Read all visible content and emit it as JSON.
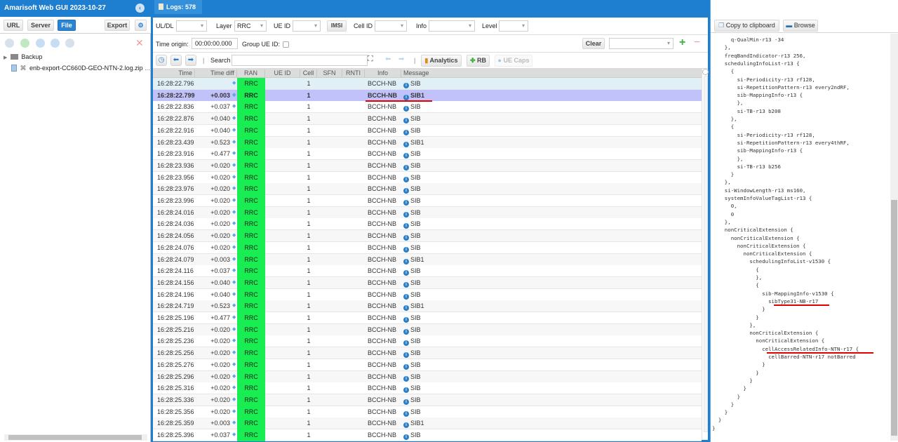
{
  "app": {
    "title": "Amarisoft Web GUI 2023-10-27",
    "left_tabs": [
      "URL",
      "Server",
      "File"
    ],
    "active_left_tab": "File",
    "export_label": "Export",
    "tree": [
      {
        "type": "folder",
        "label": "Backup"
      },
      {
        "type": "file",
        "label": "enb-export-CC660D-GEO-NTN-2.log.zip",
        "suffix": "..."
      }
    ]
  },
  "logs_tab": {
    "label": "Logs: 578"
  },
  "filters": {
    "uldl": {
      "label": "UL/DL",
      "value": ""
    },
    "layer": {
      "label": "Layer",
      "value": "RRC"
    },
    "ueid": {
      "label": "UE ID",
      "value": ""
    },
    "imsi_label": "IMSI",
    "cellid": {
      "label": "Cell ID",
      "value": ""
    },
    "info": {
      "label": "Info",
      "value": ""
    },
    "level": {
      "label": "Level",
      "value": ""
    },
    "time_origin": {
      "label": "Time origin:",
      "value": "00:00:00.000"
    },
    "group_ueid": {
      "label": "Group UE ID:",
      "checked": false
    },
    "clear_label": "Clear",
    "preset_value": ""
  },
  "toolbar": {
    "search_label": "Search",
    "search_value": "",
    "analytics_label": "Analytics",
    "rb_label": "RB",
    "uecaps_label": "UE Caps"
  },
  "table": {
    "columns": [
      "Time",
      "Time diff",
      "RAN",
      "UE ID",
      "Cell",
      "SFN",
      "RNTI",
      "Info",
      "Message"
    ],
    "selected_index": 1,
    "rows": [
      {
        "time": "16:28:22.796",
        "diff": "",
        "ran": "RRC",
        "ueid": "",
        "cell": "1",
        "sfn": "",
        "rnti": "",
        "info": "BCCH-NB",
        "msg": "SIB"
      },
      {
        "time": "16:28:22.799",
        "diff": "+0.003",
        "ran": "RRC",
        "ueid": "",
        "cell": "1",
        "sfn": "",
        "rnti": "",
        "info": "BCCH-NB",
        "msg": "SIB1"
      },
      {
        "time": "16:28:22.836",
        "diff": "+0.037",
        "ran": "RRC",
        "ueid": "",
        "cell": "1",
        "sfn": "",
        "rnti": "",
        "info": "BCCH-NB",
        "msg": "SIB"
      },
      {
        "time": "16:28:22.876",
        "diff": "+0.040",
        "ran": "RRC",
        "ueid": "",
        "cell": "1",
        "sfn": "",
        "rnti": "",
        "info": "BCCH-NB",
        "msg": "SIB"
      },
      {
        "time": "16:28:22.916",
        "diff": "+0.040",
        "ran": "RRC",
        "ueid": "",
        "cell": "1",
        "sfn": "",
        "rnti": "",
        "info": "BCCH-NB",
        "msg": "SIB"
      },
      {
        "time": "16:28:23.439",
        "diff": "+0.523",
        "ran": "RRC",
        "ueid": "",
        "cell": "1",
        "sfn": "",
        "rnti": "",
        "info": "BCCH-NB",
        "msg": "SIB1"
      },
      {
        "time": "16:28:23.916",
        "diff": "+0.477",
        "ran": "RRC",
        "ueid": "",
        "cell": "1",
        "sfn": "",
        "rnti": "",
        "info": "BCCH-NB",
        "msg": "SIB"
      },
      {
        "time": "16:28:23.936",
        "diff": "+0.020",
        "ran": "RRC",
        "ueid": "",
        "cell": "1",
        "sfn": "",
        "rnti": "",
        "info": "BCCH-NB",
        "msg": "SIB"
      },
      {
        "time": "16:28:23.956",
        "diff": "+0.020",
        "ran": "RRC",
        "ueid": "",
        "cell": "1",
        "sfn": "",
        "rnti": "",
        "info": "BCCH-NB",
        "msg": "SIB"
      },
      {
        "time": "16:28:23.976",
        "diff": "+0.020",
        "ran": "RRC",
        "ueid": "",
        "cell": "1",
        "sfn": "",
        "rnti": "",
        "info": "BCCH-NB",
        "msg": "SIB"
      },
      {
        "time": "16:28:23.996",
        "diff": "+0.020",
        "ran": "RRC",
        "ueid": "",
        "cell": "1",
        "sfn": "",
        "rnti": "",
        "info": "BCCH-NB",
        "msg": "SIB"
      },
      {
        "time": "16:28:24.016",
        "diff": "+0.020",
        "ran": "RRC",
        "ueid": "",
        "cell": "1",
        "sfn": "",
        "rnti": "",
        "info": "BCCH-NB",
        "msg": "SIB"
      },
      {
        "time": "16:28:24.036",
        "diff": "+0.020",
        "ran": "RRC",
        "ueid": "",
        "cell": "1",
        "sfn": "",
        "rnti": "",
        "info": "BCCH-NB",
        "msg": "SIB"
      },
      {
        "time": "16:28:24.056",
        "diff": "+0.020",
        "ran": "RRC",
        "ueid": "",
        "cell": "1",
        "sfn": "",
        "rnti": "",
        "info": "BCCH-NB",
        "msg": "SIB"
      },
      {
        "time": "16:28:24.076",
        "diff": "+0.020",
        "ran": "RRC",
        "ueid": "",
        "cell": "1",
        "sfn": "",
        "rnti": "",
        "info": "BCCH-NB",
        "msg": "SIB"
      },
      {
        "time": "16:28:24.079",
        "diff": "+0.003",
        "ran": "RRC",
        "ueid": "",
        "cell": "1",
        "sfn": "",
        "rnti": "",
        "info": "BCCH-NB",
        "msg": "SIB1"
      },
      {
        "time": "16:28:24.116",
        "diff": "+0.037",
        "ran": "RRC",
        "ueid": "",
        "cell": "1",
        "sfn": "",
        "rnti": "",
        "info": "BCCH-NB",
        "msg": "SIB"
      },
      {
        "time": "16:28:24.156",
        "diff": "+0.040",
        "ran": "RRC",
        "ueid": "",
        "cell": "1",
        "sfn": "",
        "rnti": "",
        "info": "BCCH-NB",
        "msg": "SIB"
      },
      {
        "time": "16:28:24.196",
        "diff": "+0.040",
        "ran": "RRC",
        "ueid": "",
        "cell": "1",
        "sfn": "",
        "rnti": "",
        "info": "BCCH-NB",
        "msg": "SIB"
      },
      {
        "time": "16:28:24.719",
        "diff": "+0.523",
        "ran": "RRC",
        "ueid": "",
        "cell": "1",
        "sfn": "",
        "rnti": "",
        "info": "BCCH-NB",
        "msg": "SIB1"
      },
      {
        "time": "16:28:25.196",
        "diff": "+0.477",
        "ran": "RRC",
        "ueid": "",
        "cell": "1",
        "sfn": "",
        "rnti": "",
        "info": "BCCH-NB",
        "msg": "SIB"
      },
      {
        "time": "16:28:25.216",
        "diff": "+0.020",
        "ran": "RRC",
        "ueid": "",
        "cell": "1",
        "sfn": "",
        "rnti": "",
        "info": "BCCH-NB",
        "msg": "SIB"
      },
      {
        "time": "16:28:25.236",
        "diff": "+0.020",
        "ran": "RRC",
        "ueid": "",
        "cell": "1",
        "sfn": "",
        "rnti": "",
        "info": "BCCH-NB",
        "msg": "SIB"
      },
      {
        "time": "16:28:25.256",
        "diff": "+0.020",
        "ran": "RRC",
        "ueid": "",
        "cell": "1",
        "sfn": "",
        "rnti": "",
        "info": "BCCH-NB",
        "msg": "SIB"
      },
      {
        "time": "16:28:25.276",
        "diff": "+0.020",
        "ran": "RRC",
        "ueid": "",
        "cell": "1",
        "sfn": "",
        "rnti": "",
        "info": "BCCH-NB",
        "msg": "SIB"
      },
      {
        "time": "16:28:25.296",
        "diff": "+0.020",
        "ran": "RRC",
        "ueid": "",
        "cell": "1",
        "sfn": "",
        "rnti": "",
        "info": "BCCH-NB",
        "msg": "SIB"
      },
      {
        "time": "16:28:25.316",
        "diff": "+0.020",
        "ran": "RRC",
        "ueid": "",
        "cell": "1",
        "sfn": "",
        "rnti": "",
        "info": "BCCH-NB",
        "msg": "SIB"
      },
      {
        "time": "16:28:25.336",
        "diff": "+0.020",
        "ran": "RRC",
        "ueid": "",
        "cell": "1",
        "sfn": "",
        "rnti": "",
        "info": "BCCH-NB",
        "msg": "SIB"
      },
      {
        "time": "16:28:25.356",
        "diff": "+0.020",
        "ran": "RRC",
        "ueid": "",
        "cell": "1",
        "sfn": "",
        "rnti": "",
        "info": "BCCH-NB",
        "msg": "SIB"
      },
      {
        "time": "16:28:25.359",
        "diff": "+0.003",
        "ran": "RRC",
        "ueid": "",
        "cell": "1",
        "sfn": "",
        "rnti": "",
        "info": "BCCH-NB",
        "msg": "SIB1"
      },
      {
        "time": "16:28:25.396",
        "diff": "+0.037",
        "ran": "RRC",
        "ueid": "",
        "cell": "1",
        "sfn": "",
        "rnti": "",
        "info": "BCCH-NB",
        "msg": "SIB"
      }
    ]
  },
  "detail": {
    "copy_label": "Copy to clipboard",
    "browse_label": "Browse",
    "highlighted_lines": [
      29,
      35
    ],
    "lines": [
      "      q-QualMin-r13 -34",
      "    },",
      "    freqBandIndicator-r13 256,",
      "    schedulingInfoList-r13 {",
      "      {",
      "        si-Periodicity-r13 rf128,",
      "        si-RepetitionPattern-r13 every2ndRF,",
      "        sib-MappingInfo-r13 {",
      "        },",
      "        si-TB-r13 b208",
      "      },",
      "      {",
      "        si-Periodicity-r13 rf128,",
      "        si-RepetitionPattern-r13 every4thRF,",
      "        sib-MappingInfo-r13 {",
      "        },",
      "        si-TB-r13 b256",
      "      }",
      "    },",
      "    si-WindowLength-r13 ms160,",
      "    systemInfoValueTagList-r13 {",
      "      0,",
      "      0",
      "    },",
      "    nonCriticalExtension {",
      "      nonCriticalExtension {",
      "        nonCriticalExtension {",
      "          nonCriticalExtension {",
      "            schedulingInfoList-v1530 {",
      "              {",
      "              },",
      "              {",
      "                sib-MappingInfo-v1530 {",
      "                  sibType31-NB-r17",
      "                }",
      "              }",
      "            },",
      "            nonCriticalExtension {",
      "              nonCriticalExtension {",
      "                cellAccessRelatedInfo-NTN-r17 {",
      "                  cellBarred-NTN-r17 notBarred",
      "                }",
      "              }",
      "            }",
      "          }",
      "        }",
      "      }",
      "    }",
      "  }",
      "}"
    ]
  },
  "colors": {
    "brand_blue": "#1e7fd0",
    "ran_green": "#18ee52",
    "selected_row": "#c2c2fb",
    "annotation_red": "#e00000"
  }
}
